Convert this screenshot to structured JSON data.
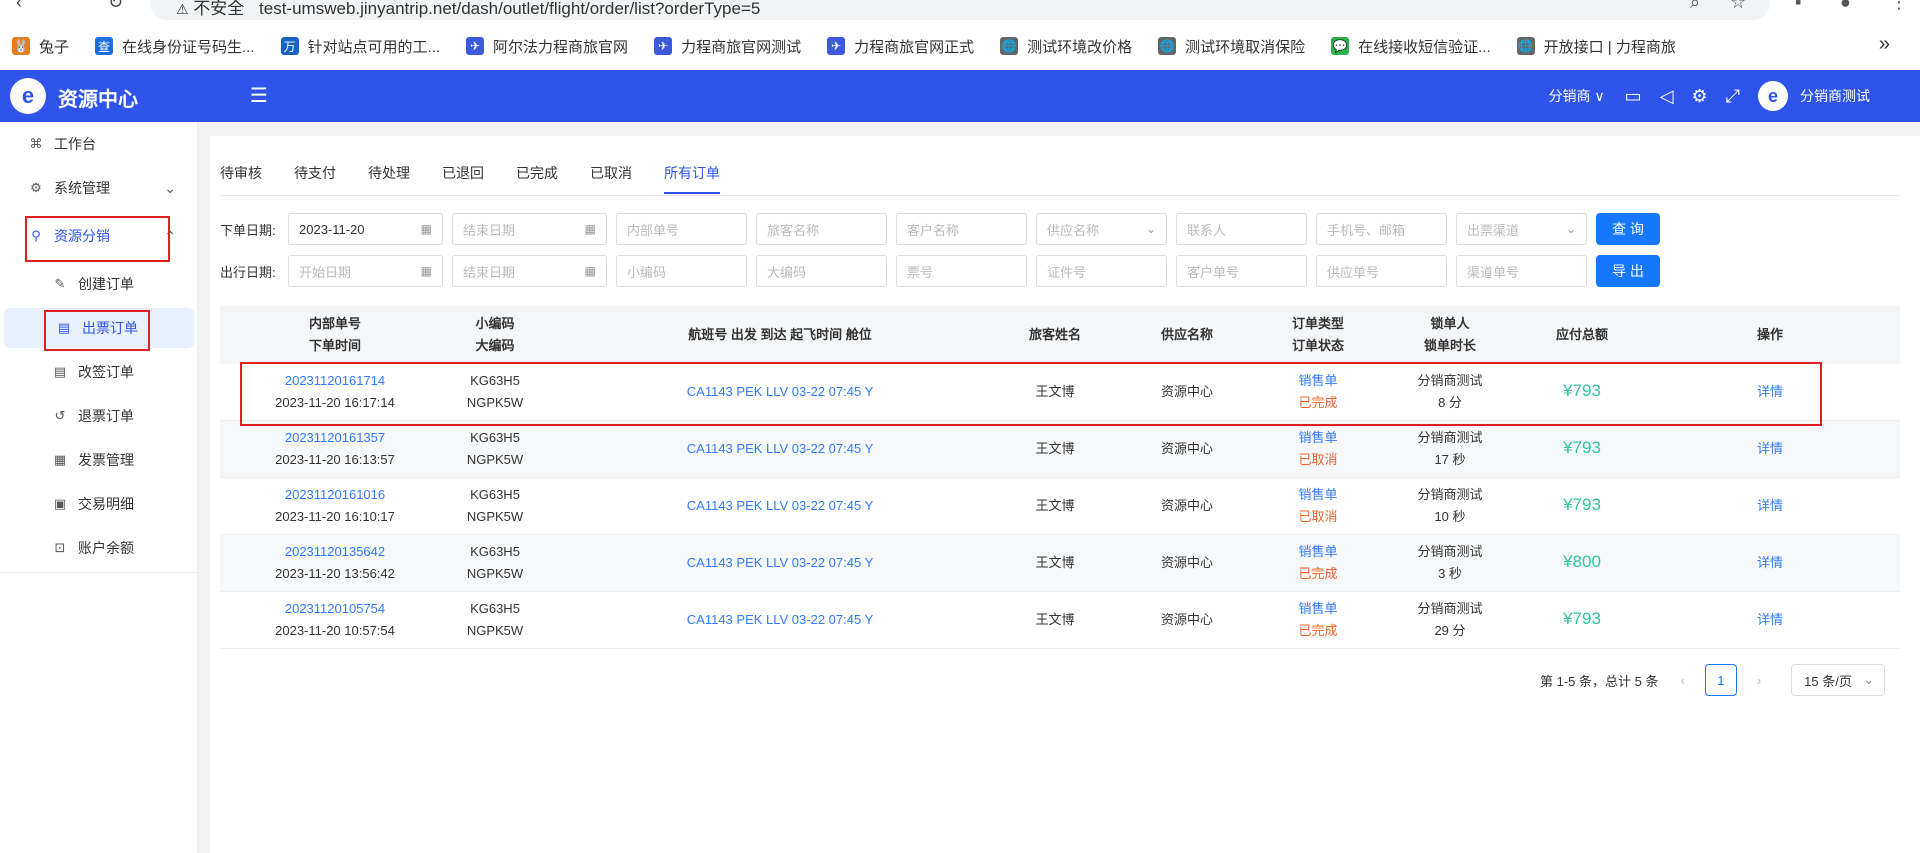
{
  "browser": {
    "address": "test-umsweb.jinyantrip.net/dash/outlet/flight/order/list?orderType=5",
    "insecure_label": "不安全",
    "bookmarks": [
      {
        "label": "兔子",
        "color": "#e87d1e",
        "glyph": "🐰"
      },
      {
        "label": "在线身份证号码生...",
        "color": "#1e6fd9",
        "glyph": "查"
      },
      {
        "label": "针对站点可用的工...",
        "color": "#1565c0",
        "glyph": "万"
      },
      {
        "label": "阿尔法力程商旅官网",
        "color": "#3b5bdb",
        "glyph": "✈"
      },
      {
        "label": "力程商旅官网测试",
        "color": "#3b5bdb",
        "glyph": "✈"
      },
      {
        "label": "力程商旅官网正式",
        "color": "#3b5bdb",
        "glyph": "✈"
      },
      {
        "label": "测试环境改价格",
        "color": "#666666",
        "glyph": "🌐"
      },
      {
        "label": "测试环境取消保险",
        "color": "#666666",
        "glyph": "🌐"
      },
      {
        "label": "在线接收短信验证...",
        "color": "#2bb24c",
        "glyph": "💬"
      },
      {
        "label": "开放接口 | 力程商旅",
        "color": "#666666",
        "glyph": "🌐"
      }
    ]
  },
  "header": {
    "title": "资源中心",
    "role": "分销商 ∨",
    "user": "分销商测试"
  },
  "sidebar": {
    "items": [
      {
        "label": "工作台",
        "icon": "workbench-icon"
      },
      {
        "label": "系统管理",
        "icon": "gear-icon"
      },
      {
        "label": "资源分销",
        "icon": "share-icon"
      },
      {
        "label": "创建订单",
        "icon": "edit-icon"
      },
      {
        "label": "出票订单",
        "icon": "list-icon"
      },
      {
        "label": "改签订单",
        "icon": "list-icon"
      },
      {
        "label": "退票订单",
        "icon": "refund-icon"
      },
      {
        "label": "发票管理",
        "icon": "invoice-icon"
      },
      {
        "label": "交易明细",
        "icon": "detail-icon"
      },
      {
        "label": "账户余额",
        "icon": "balance-icon"
      }
    ]
  },
  "tabs": [
    "待审核",
    "待支付",
    "待处理",
    "已退回",
    "已完成",
    "已取消",
    "所有订单"
  ],
  "active_tab": "所有订单",
  "filters": {
    "row1": {
      "label": "下单日期:",
      "start_date": "2023-11-20",
      "end_placeholder": "结束日期",
      "inner_no": "内部单号",
      "passenger": "旅客名称",
      "customer": "客户名称",
      "supplier": "供应名称",
      "contact": "联系人",
      "phone_email": "手机号、邮箱",
      "channel": "出票渠道",
      "query_btn": "查 询"
    },
    "row2": {
      "label": "出行日期:",
      "start_placeholder": "开始日期",
      "end_placeholder": "结束日期",
      "small_code": "小编码",
      "big_code": "大编码",
      "ticket_no": "票号",
      "cert_no": "证件号",
      "customer_no": "客户单号",
      "supplier_no": "供应单号",
      "channel_no": "渠道单号",
      "export_btn": "导 出"
    }
  },
  "table": {
    "headers": {
      "inner_no": "内部单号",
      "order_time": "下单时间",
      "small_code": "小编码",
      "big_code": "大编码",
      "flight": "航班号 出发 到达 起飞时间 舱位",
      "passenger": "旅客姓名",
      "supplier": "供应名称",
      "order_type": "订单类型",
      "order_status": "订单状态",
      "locker": "锁单人",
      "lock_duration": "锁单时长",
      "total": "应付总额",
      "action": "操作"
    },
    "rows": [
      {
        "inner_no": "20231120161714",
        "order_time": "2023-11-20 16:17:14",
        "small_code": "KG63H5",
        "big_code": "NGPK5W",
        "flight": "CA1143 PEK LLV 03-22 07:45 Y",
        "passenger": "王文博",
        "supplier": "资源中心",
        "order_type": "销售单",
        "order_status": "已完成",
        "locker": "分销商测试",
        "lock_duration": "8 分",
        "total": "¥793",
        "action": "详情"
      },
      {
        "inner_no": "20231120161357",
        "order_time": "2023-11-20 16:13:57",
        "small_code": "KG63H5",
        "big_code": "NGPK5W",
        "flight": "CA1143 PEK LLV 03-22 07:45 Y",
        "passenger": "王文博",
        "supplier": "资源中心",
        "order_type": "销售单",
        "order_status": "已取消",
        "locker": "分销商测试",
        "lock_duration": "17 秒",
        "total": "¥793",
        "action": "详情"
      },
      {
        "inner_no": "20231120161016",
        "order_time": "2023-11-20 16:10:17",
        "small_code": "KG63H5",
        "big_code": "NGPK5W",
        "flight": "CA1143 PEK LLV 03-22 07:45 Y",
        "passenger": "王文博",
        "supplier": "资源中心",
        "order_type": "销售单",
        "order_status": "已取消",
        "locker": "分销商测试",
        "lock_duration": "10 秒",
        "total": "¥793",
        "action": "详情"
      },
      {
        "inner_no": "20231120135642",
        "order_time": "2023-11-20 13:56:42",
        "small_code": "KG63H5",
        "big_code": "NGPK5W",
        "flight": "CA1143 PEK LLV 03-22 07:45 Y",
        "passenger": "王文博",
        "supplier": "资源中心",
        "order_type": "销售单",
        "order_status": "已完成",
        "locker": "分销商测试",
        "lock_duration": "3 秒",
        "total": "¥800",
        "action": "详情"
      },
      {
        "inner_no": "20231120105754",
        "order_time": "2023-11-20 10:57:54",
        "small_code": "KG63H5",
        "big_code": "NGPK5W",
        "flight": "CA1143 PEK LLV 03-22 07:45 Y",
        "passenger": "王文博",
        "supplier": "资源中心",
        "order_type": "销售单",
        "order_status": "已完成",
        "locker": "分销商测试",
        "lock_duration": "29 分",
        "total": "¥793",
        "action": "详情"
      }
    ]
  },
  "pagination": {
    "summary": "第 1-5 条，总计 5 条",
    "current": "1",
    "page_size": "15 条/页"
  },
  "colors": {
    "brand": "#2f54eb",
    "link": "#2f7bff",
    "cancelled": "#f0642a",
    "amount": "#30c5a0",
    "highlight": "#e02020"
  }
}
